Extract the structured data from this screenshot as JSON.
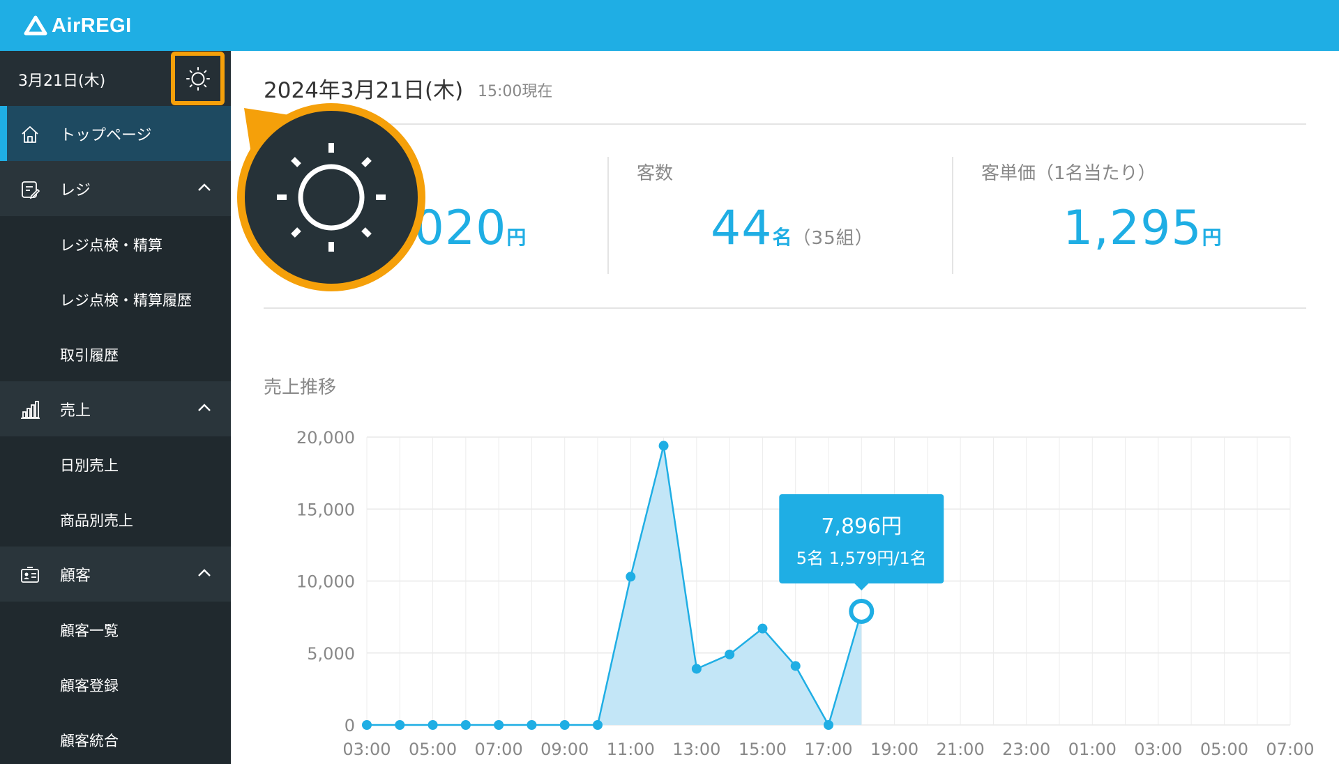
{
  "app": {
    "name": "AirREGI",
    "brand_color": "#1faee4",
    "accent_color": "#f5a00a"
  },
  "sidebar": {
    "date": "3月21日(木)",
    "weather_icon": "sun-icon",
    "items": [
      {
        "label": "トップページ",
        "icon": "home-icon",
        "active": true
      },
      {
        "label": "レジ",
        "icon": "register-icon",
        "expanded": true,
        "children": [
          "レジ点検・精算",
          "レジ点検・精算履歴",
          "取引履歴"
        ]
      },
      {
        "label": "売上",
        "icon": "bar-chart-icon",
        "expanded": true,
        "children": [
          "日別売上",
          "商品別売上"
        ]
      },
      {
        "label": "顧客",
        "icon": "customer-card-icon",
        "expanded": true,
        "children": [
          "顧客一覧",
          "顧客登録",
          "顧客統合"
        ]
      }
    ]
  },
  "main": {
    "date": "2024年3月21日(木)",
    "as_of": "15:00現在",
    "stats": [
      {
        "label": "",
        "value": ",020",
        "unit": "円",
        "extra": ""
      },
      {
        "label": "客数",
        "value": "44",
        "unit": "名",
        "extra": "（35組）"
      },
      {
        "label": "客単価（1名当たり）",
        "value": "1,295",
        "unit": "円",
        "extra": ""
      }
    ],
    "chart_title": "売上推移",
    "tooltip": {
      "amount": "7,896円",
      "detail": "5名 1,579円/1名"
    }
  },
  "chart_data": {
    "type": "area",
    "title": "売上推移",
    "xlabel": "",
    "ylabel": "",
    "ylim": [
      0,
      20000
    ],
    "yticks": [
      0,
      5000,
      10000,
      15000,
      20000
    ],
    "ytick_labels": [
      "0",
      "5,000",
      "10,000",
      "15,000",
      "20,000"
    ],
    "xtick_labels": [
      "03:00",
      "05:00",
      "07:00",
      "09:00",
      "11:00",
      "13:00",
      "15:00",
      "17:00",
      "19:00",
      "21:00",
      "23:00",
      "01:00",
      "03:00",
      "05:00",
      "07:00"
    ],
    "x_hours": [
      3,
      4,
      5,
      6,
      7,
      8,
      9,
      10,
      11,
      12,
      13,
      14,
      15,
      16,
      17,
      18
    ],
    "values": [
      0,
      0,
      0,
      0,
      0,
      0,
      0,
      0,
      10300,
      19400,
      3900,
      4900,
      6700,
      4100,
      0,
      7896
    ],
    "highlight_index": 15,
    "grid": true,
    "color": "#1faee4",
    "fill_color": "#c3e6f7"
  }
}
